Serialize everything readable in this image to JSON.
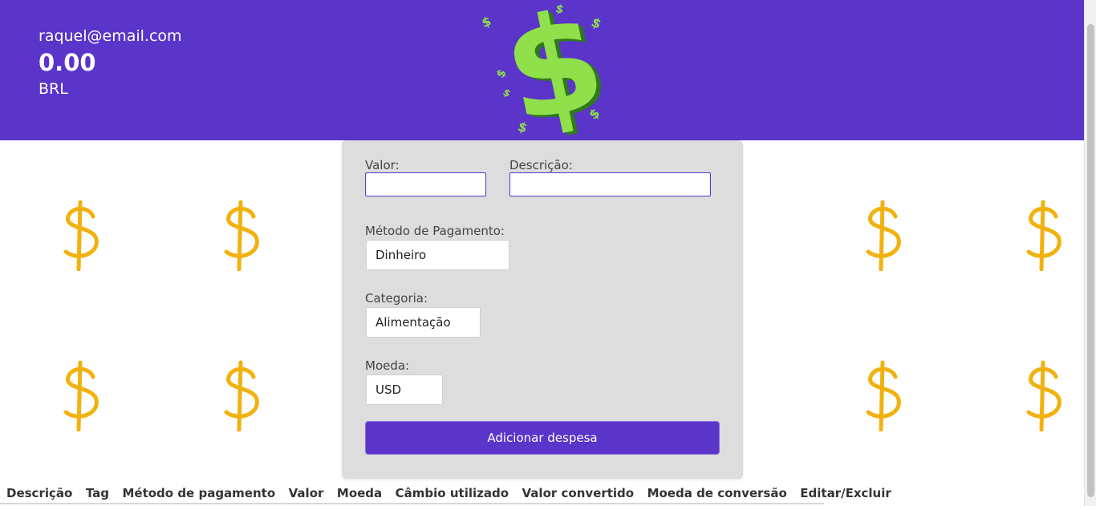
{
  "header": {
    "email": "raquel@email.com",
    "total": "0.00",
    "currency": "BRL"
  },
  "form": {
    "valor_label": "Valor:",
    "valor_value": "",
    "descricao_label": "Descrição:",
    "descricao_value": "",
    "metodo_label": "Método de Pagamento:",
    "metodo_value": "Dinheiro",
    "categoria_label": "Categoria:",
    "categoria_value": "Alimentação",
    "moeda_label": "Moeda:",
    "moeda_value": "USD",
    "submit_label": "Adicionar despesa"
  },
  "table": {
    "columns": [
      "Descrição",
      "Tag",
      "Método de pagamento",
      "Valor",
      "Moeda",
      "Câmbio utilizado",
      "Valor convertido",
      "Moeda de conversão",
      "Editar/Excluir"
    ]
  },
  "colors": {
    "brand": "#5b34c9",
    "logo_green": "#8fe04a",
    "background_dollar": "#f2b10d"
  },
  "icons": {
    "logo": "dollar-logo-icon",
    "background": "dollar-sign-icon"
  }
}
